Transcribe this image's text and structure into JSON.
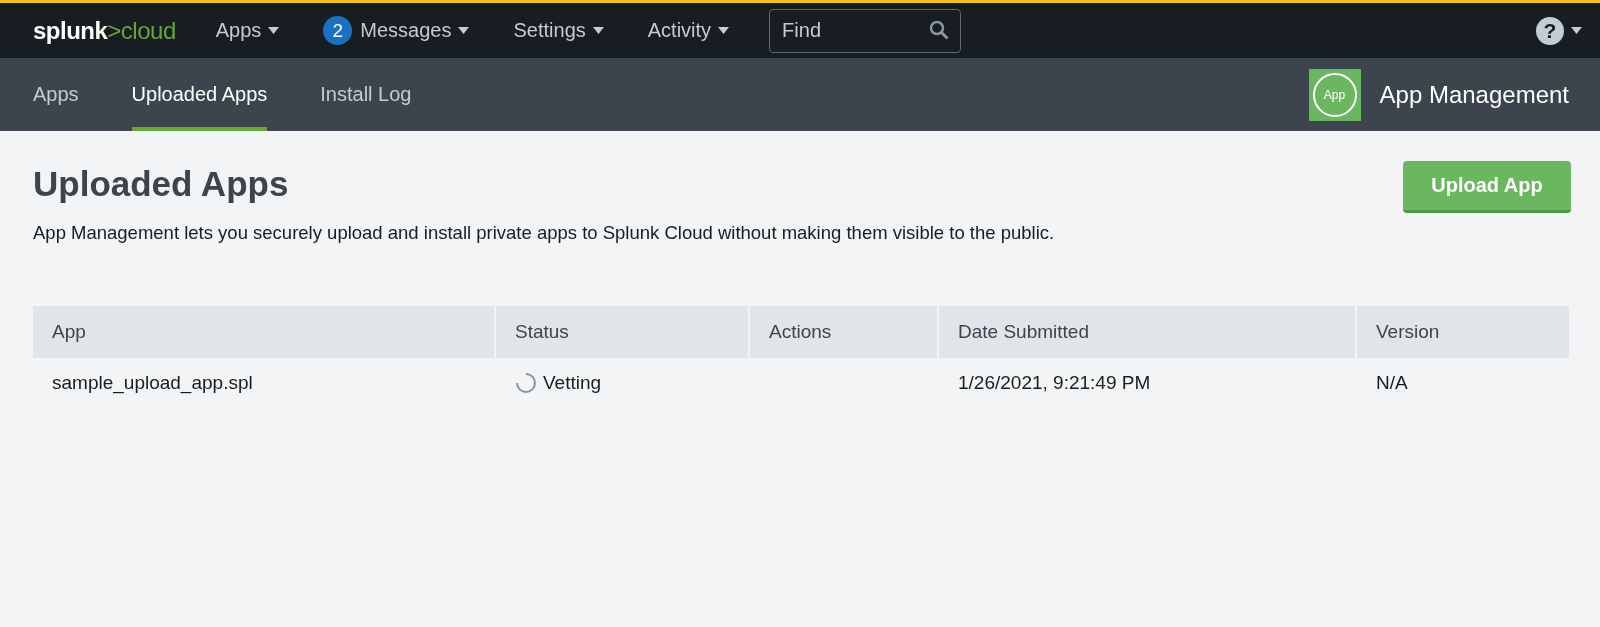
{
  "top_bar": {
    "logo": {
      "brand": "splunk",
      "product": ">cloud"
    },
    "menu": [
      {
        "label": "Apps"
      },
      {
        "label": "Messages",
        "badge": "2"
      },
      {
        "label": "Settings"
      },
      {
        "label": "Activity"
      }
    ],
    "search": {
      "placeholder": "Find"
    },
    "help": {
      "label": "?"
    }
  },
  "sub_nav": {
    "tabs": [
      {
        "label": "Apps",
        "selected": false
      },
      {
        "label": "Uploaded Apps",
        "selected": true
      },
      {
        "label": "Install Log",
        "selected": false
      }
    ],
    "app_icon": "App",
    "app_title": "App Management"
  },
  "page": {
    "title": "Uploaded Apps",
    "description": "App Management lets you securely upload and install private apps to Splunk Cloud without making them visible to the public.",
    "upload_button": "Upload App"
  },
  "table": {
    "columns": [
      "App",
      "Status",
      "Actions",
      "Date Submitted",
      "Version"
    ],
    "rows": [
      {
        "app": "sample_upload_app.spl",
        "status": {
          "label": "Vetting",
          "kind": "pending"
        },
        "date_submitted": "1/26/2021, 9:21:49 PM",
        "version": "N/A"
      }
    ]
  }
}
